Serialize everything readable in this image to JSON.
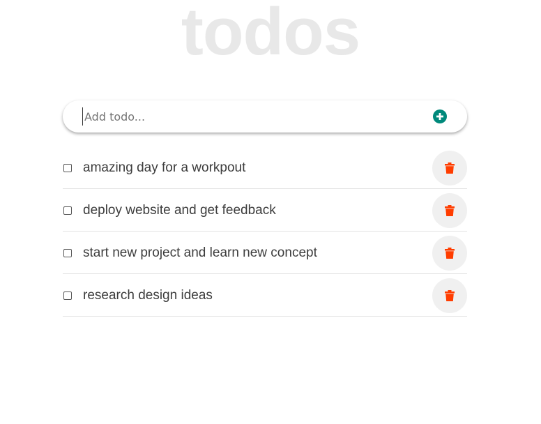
{
  "app": {
    "title": "todos"
  },
  "input": {
    "placeholder": "Add todo...",
    "value": ""
  },
  "colors": {
    "accent": "#00897b",
    "delete": "#ff3d00",
    "title": "#e8e8e8"
  },
  "icons": {
    "add": "plus-circle-icon",
    "delete": "trash-icon",
    "checkbox": "checkbox-unchecked"
  },
  "todos": [
    {
      "text": "amazing day for a workpout",
      "done": false
    },
    {
      "text": "deploy website and get feedback",
      "done": false
    },
    {
      "text": "start new project and learn new concept",
      "done": false
    },
    {
      "text": "research design ideas",
      "done": false
    }
  ]
}
